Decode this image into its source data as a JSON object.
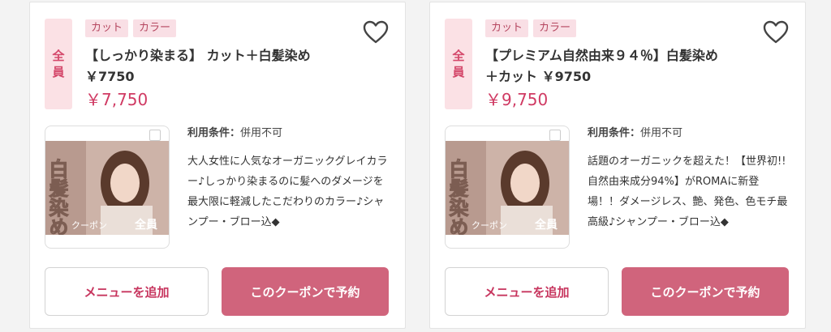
{
  "coupons": [
    {
      "audience": "全員",
      "tags": [
        "カット",
        "カラー"
      ],
      "title": "【しっかり染まる】 カット＋白髪染め ￥7750",
      "price": "￥7,750",
      "conditions_label": "利用条件：",
      "conditions_value": "併用不可",
      "description": "大人女性に人気なオーガニックグレイカラー♪しっかり染まるのに髪へのダメージを最大限に軽減したこだわりのカラー♪シャンプー・ブロー込◆",
      "image": {
        "vertical_text": "白髪染め",
        "overlay_text": "クーポン",
        "badge": "全員"
      },
      "add_menu_label": "メニューを追加",
      "book_label": "このクーポンで予約"
    },
    {
      "audience": "全員",
      "tags": [
        "カット",
        "カラー"
      ],
      "title": "【プレミアム自然由来９４％】白髪染め＋カット ￥9750",
      "price": "￥9,750",
      "conditions_label": "利用条件：",
      "conditions_value": "併用不可",
      "description": "話題のオーガニックを超えた！【世界初!!自然由来成分94%】がROMAに新登場！！ダメージレス、艶、発色、色モチ最高級♪シャンプー・ブロー込◆",
      "image": {
        "vertical_text": "白髪染め",
        "overlay_text": "クーポン",
        "badge": "全員"
      },
      "add_menu_label": "メニューを追加",
      "book_label": "このクーポンで予約"
    }
  ],
  "colors": {
    "accent": "#d03a63",
    "button": "#d0647c",
    "tag_bg": "#f9dfe5"
  },
  "icons": {
    "favorite": "heart-outline-icon"
  }
}
